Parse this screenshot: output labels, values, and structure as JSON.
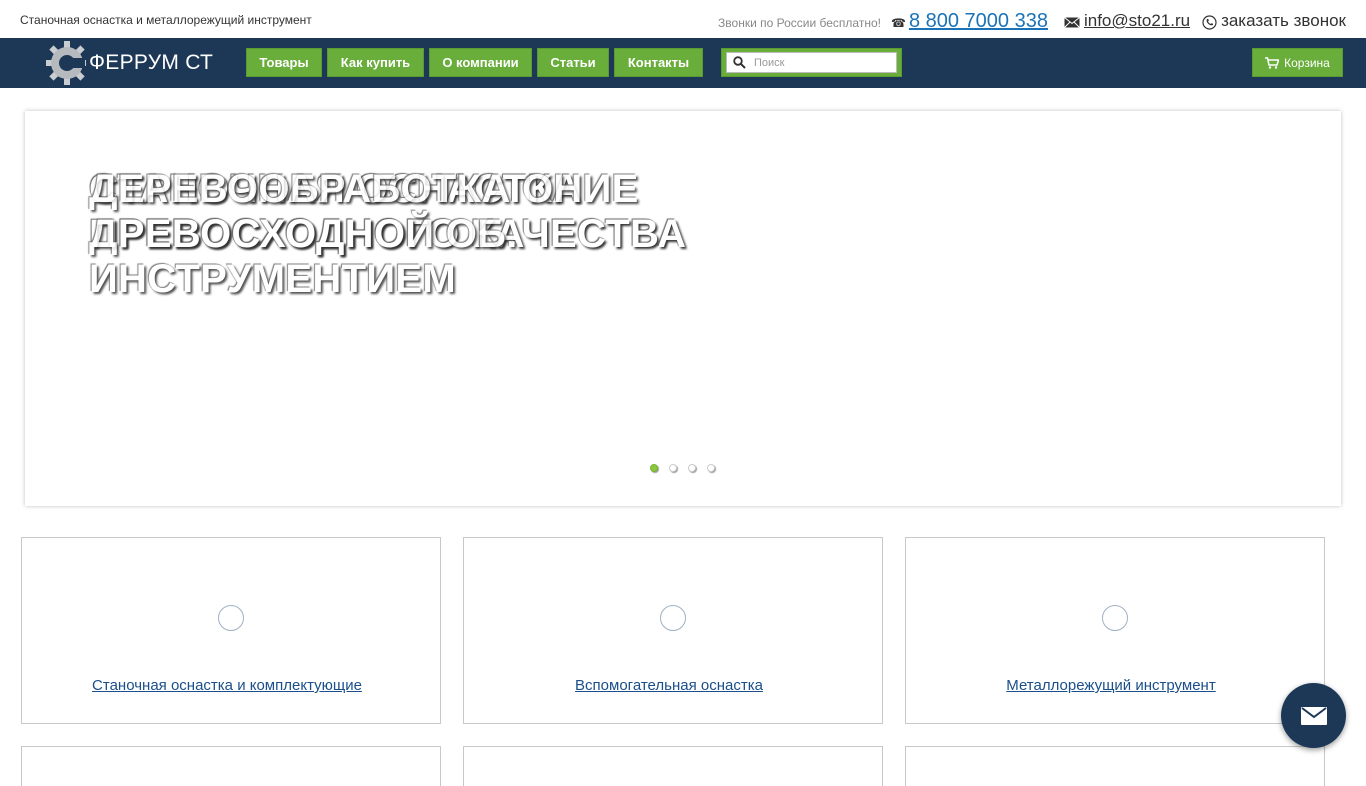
{
  "topbar": {
    "tagline": "Станочная оснастка и металлорежущий инструмент",
    "free_calls": "Звонки по России бесплатно!",
    "phone": "8 800 7000 338",
    "email": "info@sto21.ru",
    "callback": "заказать звонок"
  },
  "navbar": {
    "logo_text": "ФЕРРУМ СТ",
    "items": [
      {
        "label": "Товары"
      },
      {
        "label": "Как купить"
      },
      {
        "label": "О компании"
      },
      {
        "label": "Статьи"
      },
      {
        "label": "Контакты"
      }
    ],
    "search_placeholder": "Поиск",
    "cart_label": "Корзина"
  },
  "slider": {
    "title_a": [
      "СТАНОЧНАЯ ОСНАСТКА",
      "ПРЕВОСХОДНОГО КАЧЕСТВА"
    ],
    "title_b": [
      "ДЕРЕВООБРАБОТКА ОНИЕ",
      "ДРЕВОСХОДНОЙ ОБ.",
      "ИНСТРУМЕНТИЕМ"
    ],
    "dots_count": 4,
    "active_dot": 1
  },
  "categories": [
    {
      "label": "Станочная оснастка и комплектующие"
    },
    {
      "label": "Вспомогательная оснастка"
    },
    {
      "label": "Металлорежущий инструмент"
    }
  ],
  "colors": {
    "navbar_bg": "#1d3857",
    "button_green": "#69ad3b",
    "link_blue": "#1a4f8b",
    "phone_blue": "#1a73b8"
  }
}
